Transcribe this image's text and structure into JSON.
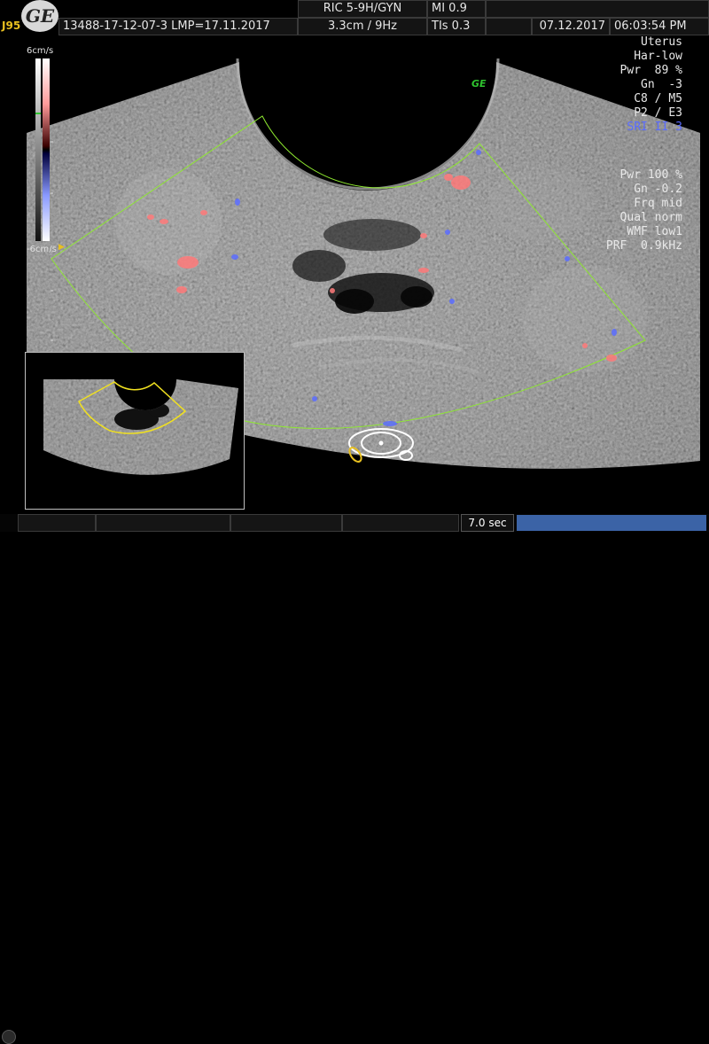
{
  "header": {
    "logo_text": "GE",
    "station_id": "J95",
    "patient_id": "13488-17-12-07-3",
    "lmp": "LMP=17.11.2017",
    "probe": "RIC 5-9H/GYN",
    "mi": "MI  0.9",
    "depth_freq": "3.3cm /  9Hz",
    "tis": "TIs  0.3",
    "date": "07.12.2017",
    "time": "06:03:54 PM"
  },
  "bmode_params": [
    "Uterus",
    "Har-low",
    "Pwr  89 %",
    "Gn  -3",
    "C8 / M5",
    "P2 / E3"
  ],
  "sri_label": "SRI II 3",
  "color_params": [
    "Pwr 100 %",
    "Gn -0.2",
    "Frq mid",
    "Qual norm",
    "WMF low1",
    "PRF  0.9kHz"
  ],
  "color_scale": {
    "top": "6cm/s",
    "bottom": "-6cm/s"
  },
  "probe_mark": "GE",
  "footer": {
    "cine_time": "7.0 sec"
  },
  "colors": {
    "box": "#8ee830",
    "sri": "#5a6cff",
    "station": "#e8c020",
    "cine": "#3b63a6"
  }
}
